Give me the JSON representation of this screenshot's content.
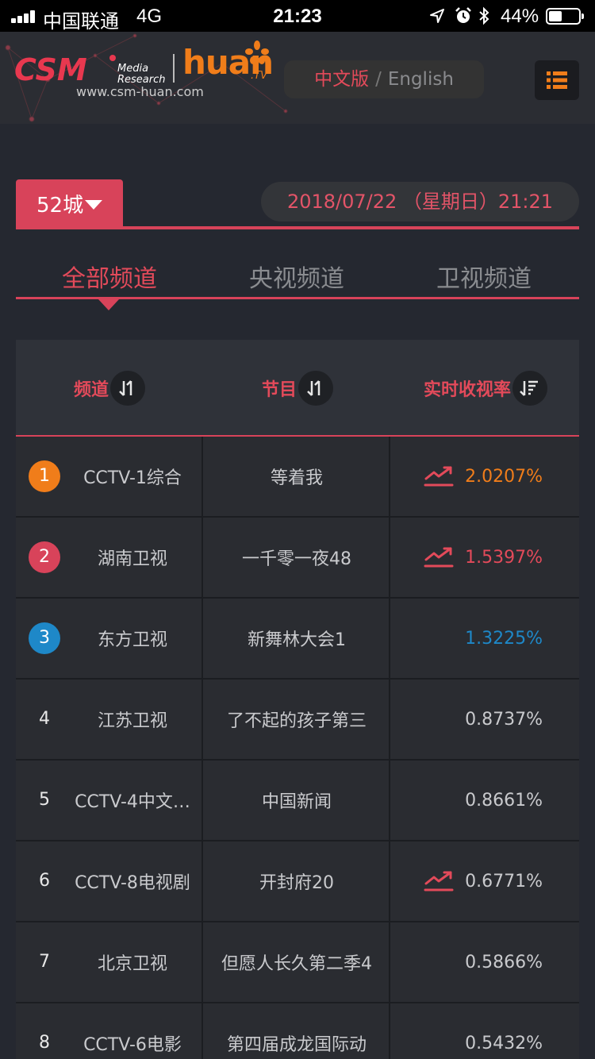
{
  "status_bar": {
    "carrier": "中国联通",
    "network": "4G",
    "time": "21:23",
    "battery": "44%",
    "battery_level": 0.44
  },
  "header": {
    "logo_csm": "CSM",
    "logo_csm_sub1": "Media",
    "logo_csm_sub2": "Research",
    "logo_huan": "huan",
    "logo_huan_tv": ".TV",
    "site_url": "www.csm-huan.com",
    "lang_cn": "中文版",
    "lang_sep": "/",
    "lang_en": "English",
    "menu_icon": "list-menu-icon"
  },
  "filter": {
    "city": "52城",
    "datetime": "2018/07/22 （星期日）21:21"
  },
  "tabs": [
    {
      "label": "全部频道",
      "active": true
    },
    {
      "label": "央视频道",
      "active": false
    },
    {
      "label": "卫视频道",
      "active": false
    }
  ],
  "table": {
    "headers": [
      "频道",
      "节目",
      "实时收视率"
    ],
    "rows": [
      {
        "rank": "1",
        "channel": "CCTV-1综合",
        "program": "等着我",
        "rating": "2.0207%",
        "trend": true
      },
      {
        "rank": "2",
        "channel": "湖南卫视",
        "program": "一千零一夜48",
        "rating": "1.5397%",
        "trend": true
      },
      {
        "rank": "3",
        "channel": "东方卫视",
        "program": "新舞林大会1",
        "rating": "1.3225%",
        "trend": false
      },
      {
        "rank": "4",
        "channel": "江苏卫视",
        "program": "了不起的孩子第三",
        "rating": "0.8737%",
        "trend": false
      },
      {
        "rank": "5",
        "channel": "CCTV-4中文…",
        "program": "中国新闻",
        "rating": "0.8661%",
        "trend": false
      },
      {
        "rank": "6",
        "channel": "CCTV-8电视剧",
        "program": "开封府20",
        "rating": "0.6771%",
        "trend": true
      },
      {
        "rank": "7",
        "channel": "北京卫视",
        "program": "但愿人长久第二季4",
        "rating": "0.5866%",
        "trend": false
      },
      {
        "rank": "8",
        "channel": "CCTV-6电影",
        "program": "第四届成龙国际动",
        "rating": "0.5432%",
        "trend": false
      }
    ]
  },
  "colors": {
    "accent": "#d8435a",
    "rank1": "#f07d1a",
    "rank2": "#d8435a",
    "rank3": "#1e88c8",
    "rating1": "#f07d1a",
    "rating2": "#e34a5a",
    "rating3": "#1e88c8",
    "trend": "#e34a5a"
  }
}
